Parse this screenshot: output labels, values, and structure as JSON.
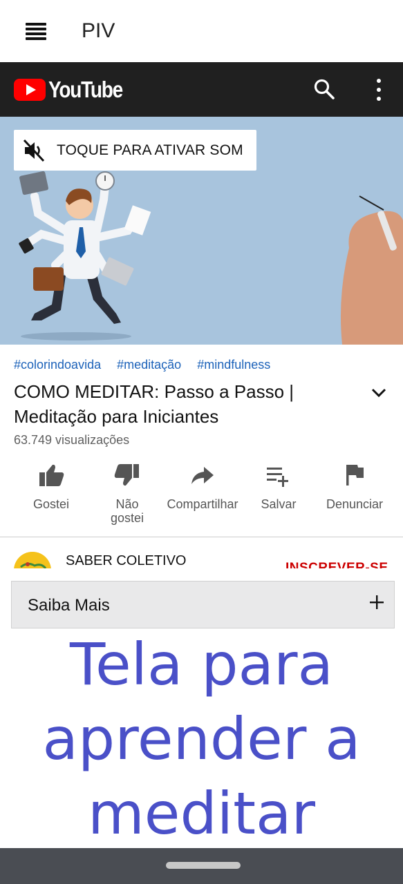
{
  "appbar": {
    "title": "PIV"
  },
  "youtube": {
    "brand": "YouTube",
    "colors": {
      "bar": "#202020",
      "logo_red": "#ff0000"
    }
  },
  "video": {
    "unmute_label": "TOQUE PARA ATIVAR SOM",
    "hashtags": [
      "#colorindoavida",
      "#meditação",
      "#mindfulness"
    ],
    "title": "COMO MEDITAR: Passo a Passo | Meditação para Iniciantes",
    "views": "63.749 visualizações"
  },
  "actions": [
    {
      "label": "Gostei",
      "icon": "thumb-up-icon"
    },
    {
      "label": "Não gostei",
      "icon": "thumb-down-icon"
    },
    {
      "label": "Compartilhar",
      "icon": "share-icon"
    },
    {
      "label": "Salvar",
      "icon": "playlist-add-icon"
    },
    {
      "label": "Denunciar",
      "icon": "flag-icon"
    }
  ],
  "channel": {
    "name": "SABER COLETIVO",
    "subscribe_label": "INSCREVER-SE"
  },
  "saiba_mais": {
    "label": "Saiba Mais",
    "toggle": "+"
  },
  "caption": [
    "Tela para",
    "aprender a",
    "meditar"
  ],
  "colors": {
    "caption": "#4a50c8",
    "hashtag": "#1c62b9",
    "navbar": "#4a4d53"
  }
}
